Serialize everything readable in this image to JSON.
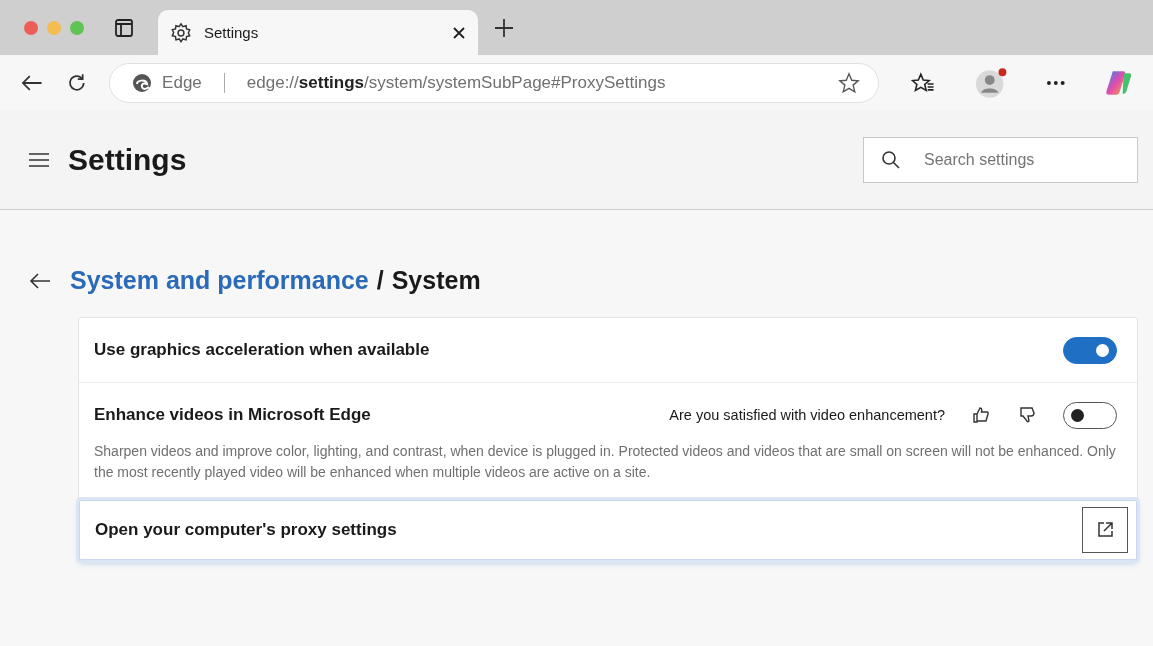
{
  "browser": {
    "tab": {
      "title": "Settings",
      "selected": true
    },
    "address_bar": {
      "site_label": "Edge",
      "url": "edge://**settings**/system/systemSubPage#ProxySettings"
    }
  },
  "header": {
    "title": "Settings",
    "search": {
      "placeholder": "Search settings"
    }
  },
  "breadcrumb": {
    "parent": "System and performance",
    "separator": "/",
    "current": "System"
  },
  "settings": [
    {
      "kind": "toggle",
      "label": "Use graphics acceleration when available",
      "on": true
    },
    {
      "kind": "toggle_feedback",
      "label": "Enhance videos in Microsoft Edge",
      "question": "Are you satisfied with video enhancement?",
      "on": false,
      "description": "Sharpen videos and improve color, lighting, and contrast, when device is plugged in. Protected videos and videos that are small on screen will not be enhanced. Only the most recently played video will be enhanced when multiple videos are active on a site."
    },
    {
      "kind": "link",
      "label": "Open your computer's proxy settings",
      "focused": true
    }
  ]
}
